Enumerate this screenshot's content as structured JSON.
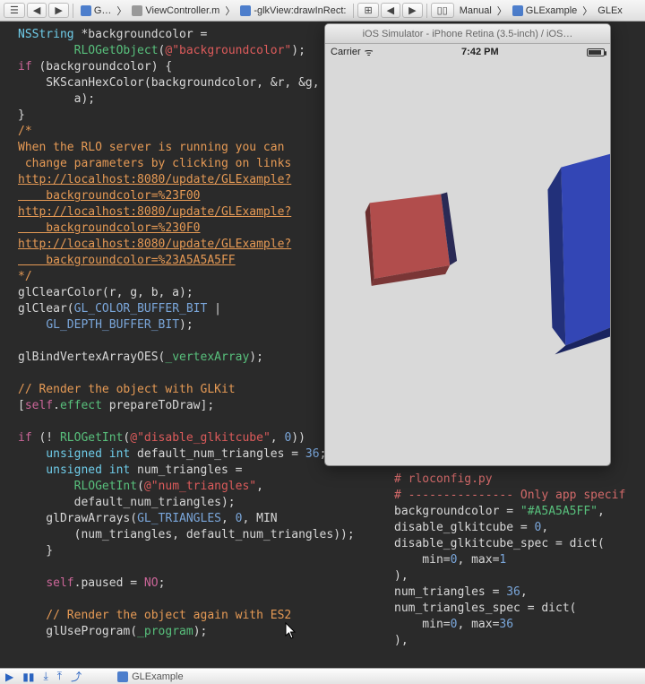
{
  "toolbar": {
    "nav_back": "◀",
    "nav_fwd": "▶",
    "item1": "G…",
    "item2": "ViewController.m",
    "item3": "M",
    "method": "-glkView:drawInRect:",
    "btn_manual": "Manual",
    "btn_example": "GLExample",
    "btn_glex": "GLEx"
  },
  "sim": {
    "title": "iOS Simulator - iPhone Retina (3.5-inch) / iOS…",
    "carrier": "Carrier",
    "time": "7:42 PM"
  },
  "code": {
    "l1a": "NSString",
    "l1b": " *backgroundcolor =",
    "l2a": "        RLOGetObject",
    "l2b": "(",
    "l2c": "@\"backgroundcolor\"",
    "l2d": ");",
    "l3a": "if",
    "l3b": " (backgroundcolor) {",
    "l4a": "    SKScanHexColor(backgroundcolor, &r, &g, &",
    "l5a": "        a);",
    "l6a": "}",
    "c1": "/*",
    "c2": "When the RLO server is running you can",
    "c3": " change parameters by clicking on links",
    "link1a": "http://localhost:8080/update/GLExample?",
    "link1b": "    backgroundcolor=%23F00",
    "link2a": "http://localhost:8080/update/GLExample?",
    "link2b": "    backgroundcolor=%230F0",
    "link3a": "http://localhost:8080/update/GLExample?",
    "link3b": "    backgroundcolor=%23A5A5A5FF",
    "c4": "*/",
    "l7a": "glClearColor(r, g, b, a);",
    "l8a": "glClear(",
    "l8b": "GL_COLOR_BUFFER_BIT",
    "l8c": " |",
    "l9a": "    ",
    "l9b": "GL_DEPTH_BUFFER_BIT",
    "l9c": ");",
    "l10a": "glBindVertexArrayOES(",
    "l10b": "_vertexArray",
    "l10c": ");",
    "c5": "// Render the object with GLKit",
    "l11a": "[",
    "l11b": "self",
    "l11c": ".",
    "l11d": "effect",
    "l11e": " prepareToDraw];",
    "l12a": "if",
    "l12b": " (! ",
    "l12c": "RLOGetInt",
    "l12d": "(",
    "l12e": "@\"disable_glkitcube\"",
    "l12f": ", ",
    "l12g": "0",
    "l12h": "))",
    "l13a": "    unsigned int",
    "l13b": " default_num_triangles = ",
    "l13c": "36",
    "l13d": ";",
    "l14a": "    unsigned int",
    "l14b": " num_triangles =",
    "l15a": "        RLOGetInt",
    "l15b": "(",
    "l15c": "@\"num_triangles\"",
    "l15d": ",",
    "l16a": "        default_num_triangles);",
    "l17a": "    glDrawArrays(",
    "l17b": "GL_TRIANGLES",
    "l17c": ", ",
    "l17d": "0",
    "l17e": ", MIN",
    "l18a": "        (num_triangles, default_num_triangles));",
    "l19": "    }",
    "l20a": "    ",
    "l20b": "self",
    "l20c": ".paused = ",
    "l20d": "NO",
    "l20e": ";",
    "c6": "    // Render the object again with ES2",
    "l21a": "    glUseProgram(",
    "l21b": "_program",
    "l21c": ");"
  },
  "rcode": {
    "r1": "# rloconfig.py",
    "r2": "# --------------- Only app specif",
    "r3a": "backgroundcolor = ",
    "r3b": "\"#A5A5A5FF\"",
    "r3c": ",",
    "r4a": "disable_glkitcube = ",
    "r4b": "0",
    "r4c": ",",
    "r5": "disable_glkitcube_spec = dict(",
    "r6a": "    min=",
    "r6b": "0",
    "r6c": ", max=",
    "r6d": "1",
    "r7": "),",
    "r8a": "num_triangles = ",
    "r8b": "36",
    "r8c": ",",
    "r9": "num_triangles_spec = dict(",
    "r10a": "    min=",
    "r10b": "0",
    "r10c": ", max=",
    "r10d": "36",
    "r11": "),"
  },
  "bottom": {
    "crumb": "GLExample",
    "wifi_glyph": "ᯤ"
  }
}
